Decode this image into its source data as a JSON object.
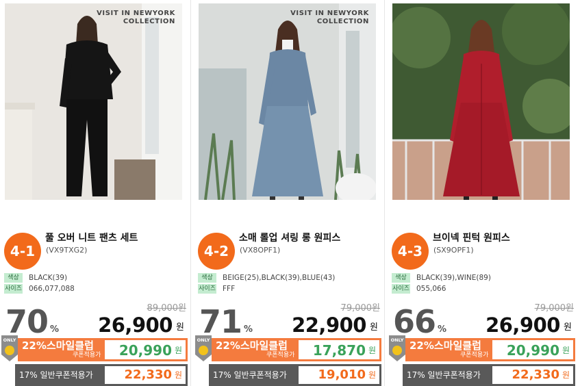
{
  "brand_line1": "VISIT IN NEWYORK",
  "brand_line2": "COLLECTION",
  "color_label": "색상",
  "size_label": "사이즈",
  "percent_sign": "%",
  "won": "원",
  "only_label": "ONLY",
  "club_label": "22%스마일클럽",
  "club_sub": "쿠폰적용가",
  "general_label": "17% 일반쿠폰적용가",
  "colors": {
    "accent": "#f26a1b",
    "club": "#f47b3e",
    "green": "#3aa25a",
    "tag_bg": "#c4ecd0"
  },
  "products": [
    {
      "rank": "4-1",
      "name": "풀 오버 니트 팬츠 세트",
      "code": "(VX9TXG2)",
      "color": "BLACK(39)",
      "size": "066,077,088",
      "discount": "70",
      "original": "89,000원",
      "sale": "26,900",
      "club_price": "20,990",
      "general_price": "22,330",
      "show_brand": true
    },
    {
      "rank": "4-2",
      "name": "소매 롤업 셔링 롱 원피스",
      "code": "(VX8OPF1)",
      "color": "BEIGE(25),BLACK(39),BLUE(43)",
      "size": "FFF",
      "discount": "71",
      "original": "79,000원",
      "sale": "22,900",
      "club_price": "17,870",
      "general_price": "19,010",
      "show_brand": true
    },
    {
      "rank": "4-3",
      "name": "브이넥 핀턱 원피스",
      "code": "(SX9OPF1)",
      "color": "BLACK(39),WINE(89)",
      "size": "055,066",
      "discount": "66",
      "original": "79,000원",
      "sale": "26,900",
      "club_price": "20,990",
      "general_price": "22,330",
      "show_brand": false
    }
  ]
}
